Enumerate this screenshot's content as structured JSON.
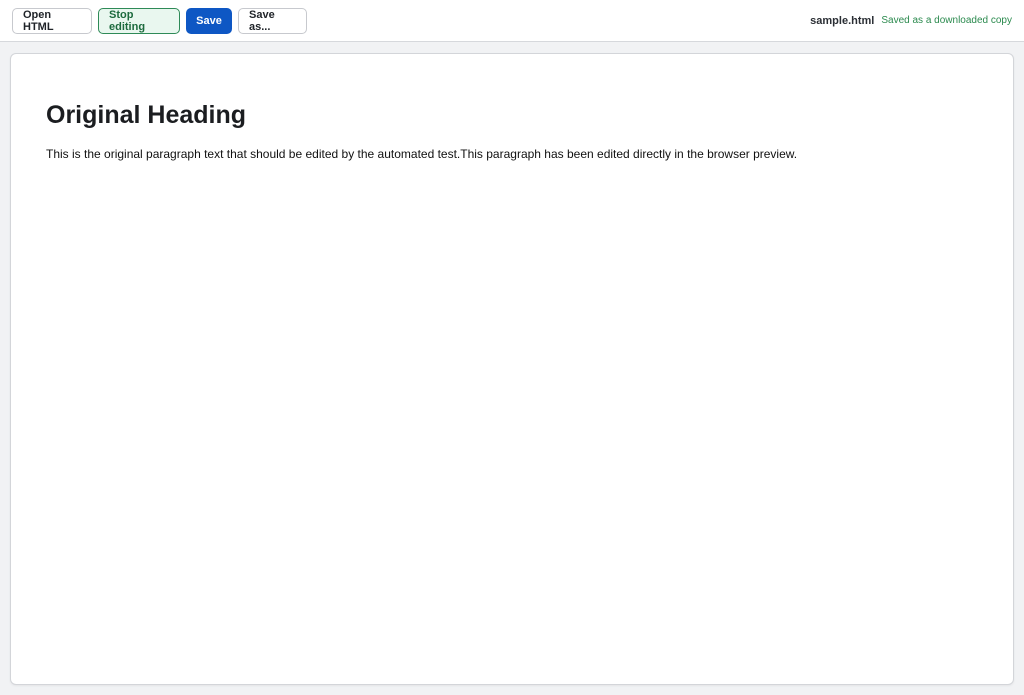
{
  "toolbar": {
    "open_label": "Open HTML",
    "stop_editing_label": "Stop editing",
    "save_label": "Save",
    "save_as_label": "Save as..."
  },
  "status": {
    "file_name": "sample.html",
    "save_status": "Saved as a downloaded copy"
  },
  "document": {
    "heading": "Original Heading",
    "paragraph": "This is the original paragraph text that should be edited by the automated test.This paragraph has been edited directly in the browser preview."
  },
  "colors": {
    "primary": "#0e57c4",
    "editing_border": "#2e8a57",
    "status_green": "#2b8a4e"
  }
}
